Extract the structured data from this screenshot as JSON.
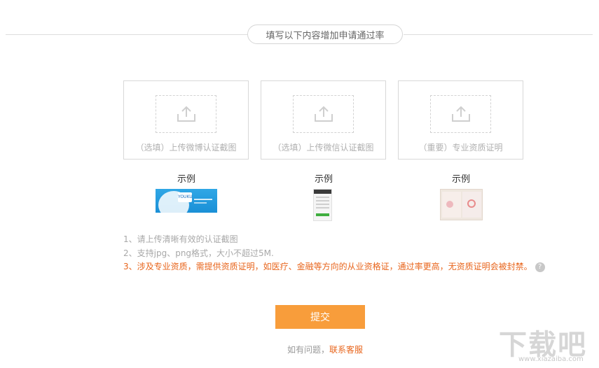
{
  "section": {
    "title": "填写以下内容增加申请通过率"
  },
  "uploads": [
    {
      "label": "（选填）上传微博认证截图",
      "icon": "upload-icon"
    },
    {
      "label": "（选填）上传微信认证截图",
      "icon": "upload-icon"
    },
    {
      "label": "（重要）专业资质证明",
      "icon": "upload-icon"
    }
  ],
  "examples": [
    {
      "title": "示例",
      "thumb_text": "YOUKU"
    },
    {
      "title": "示例"
    },
    {
      "title": "示例"
    }
  ],
  "notes": [
    "1、请上传清晰有效的认证截图",
    "2、支持jpg、png格式，大小不超过5M.",
    "3、涉及专业资质，需提供资质证明，如医疗、金融等方向的从业资格证，通过率更高，无资质证明会被封禁。"
  ],
  "help_icon": {
    "glyph": "?"
  },
  "submit": {
    "label": "提交"
  },
  "contact": {
    "prefix": "如有问题，",
    "link": "联系客服"
  },
  "watermark": {
    "logo": "下载吧",
    "url": "www.xiazaiba.com"
  },
  "colors": {
    "accent_orange": "#f89d3b",
    "warning_text": "#e8651c",
    "muted_text": "#a8a8a8",
    "border": "#d8d8d8"
  }
}
